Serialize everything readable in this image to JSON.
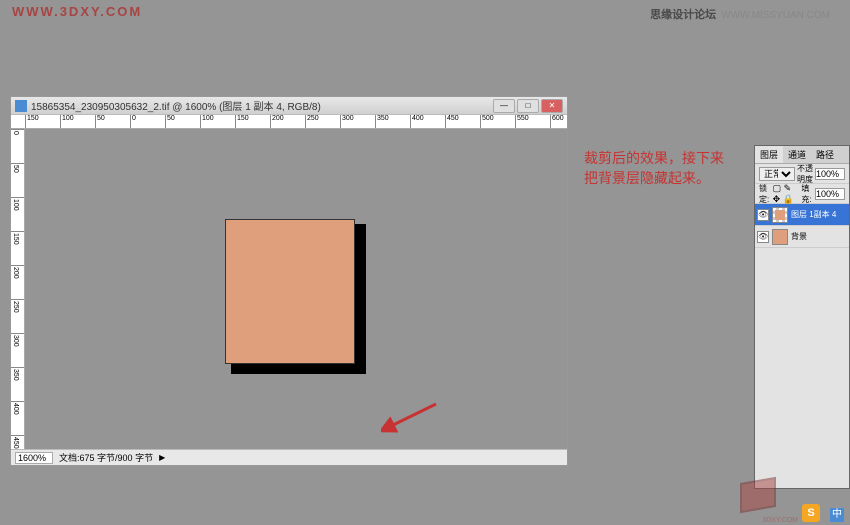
{
  "watermark_left": "WWW.3DXY.COM",
  "watermark_right": "思缘设计论坛",
  "watermark_right_url": "WWW.MISSYUAN.COM",
  "doc": {
    "title": "15865354_230950305632_2.tif @ 1600% (图层 1 副本 4, RGB/8)",
    "zoom": "1600%",
    "info": "文档:675 字节/900 字节"
  },
  "ruler_ticks": [
    "150",
    "100",
    "50",
    "0",
    "50",
    "100",
    "150",
    "200",
    "250",
    "300",
    "350",
    "400",
    "450",
    "500",
    "550",
    "600"
  ],
  "ruler_v_ticks": [
    "0",
    "50",
    "100",
    "150",
    "200",
    "250",
    "300",
    "350",
    "400",
    "450"
  ],
  "annotation": "裁剪后的效果，接下来把背景层隐藏起来。",
  "panel": {
    "tabs": [
      "图层",
      "通道",
      "路径"
    ],
    "mode_label": "正常",
    "opacity_label": "不透明度",
    "opacity_val": "100%",
    "lock_label": "锁定:",
    "fill_label": "填充:",
    "fill_val": "100%",
    "layers": [
      {
        "name": "图层 1副本 4",
        "selected": true
      },
      {
        "name": "背景",
        "selected": false
      }
    ]
  },
  "logo_3d_text": "3DXY.COM",
  "logo_s": "S",
  "logo_zh": "中"
}
